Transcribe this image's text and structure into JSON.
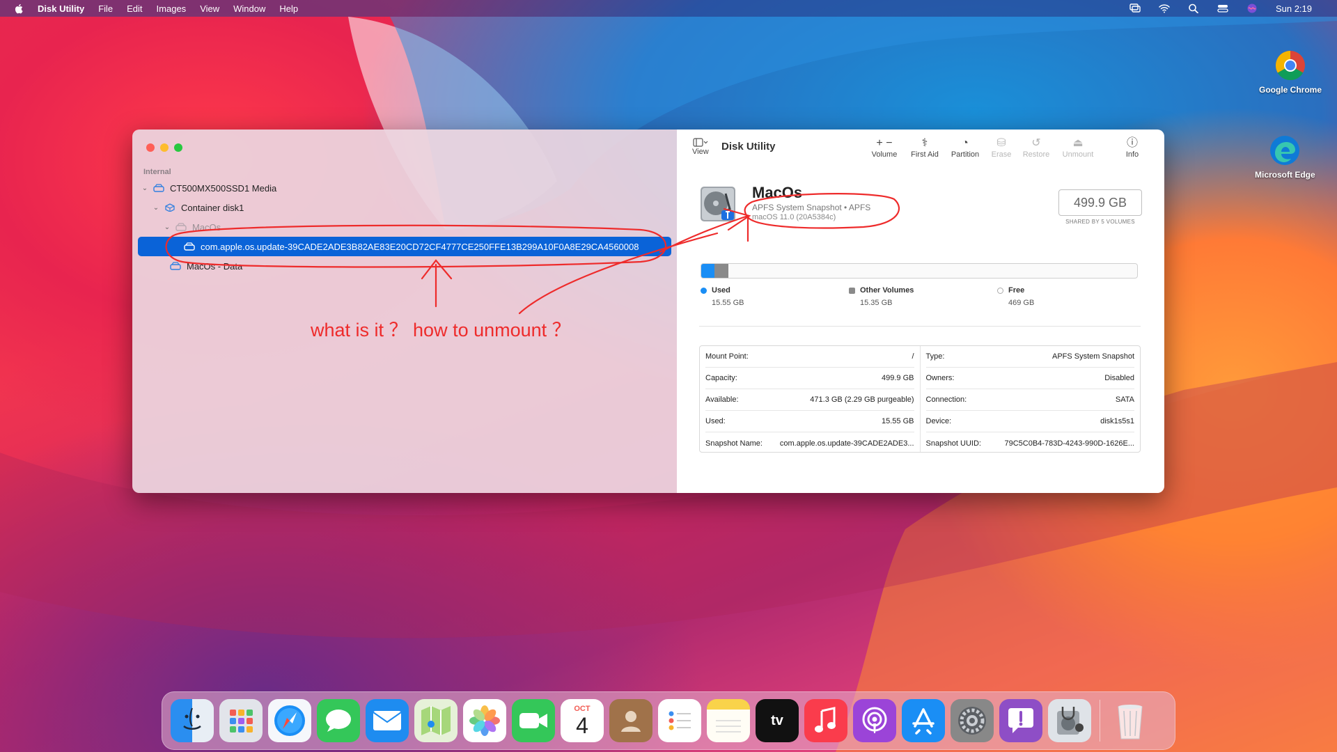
{
  "menubar": {
    "app_name": "Disk Utility",
    "items": [
      "File",
      "Edit",
      "Images",
      "View",
      "Window",
      "Help"
    ],
    "clock": "Sun 2:19"
  },
  "desktop_icons": [
    {
      "label": "Google Chrome"
    },
    {
      "label": "Microsoft Edge"
    }
  ],
  "sidebar": {
    "section": "Internal",
    "items": [
      {
        "label": "CT500MX500SSD1 Media"
      },
      {
        "label": "Container disk1"
      },
      {
        "label": "MacOs"
      },
      {
        "label": "com.apple.os.update-39CADE2ADE3B82AE83E20CD72CF4777CE250FFE13B299A10F0A8E29CA4560008"
      },
      {
        "label": "MacOs - Data"
      }
    ]
  },
  "toolbar": {
    "view_label": "View",
    "title": "Disk Utility",
    "buttons": [
      {
        "label": "Volume",
        "glyph": "+  −"
      },
      {
        "label": "First Aid",
        "glyph": "⚕"
      },
      {
        "label": "Partition",
        "glyph": "◔"
      },
      {
        "label": "Erase",
        "glyph": "⛁"
      },
      {
        "label": "Restore",
        "glyph": "↺"
      },
      {
        "label": "Unmount",
        "glyph": "⏏"
      },
      {
        "label": "Info",
        "glyph": "ⓘ"
      }
    ]
  },
  "volume": {
    "name": "MacOs",
    "subtitle": "APFS System Snapshot • APFS",
    "version": "macOS 11.0 (20A5384c)",
    "size": "499.9 GB",
    "size_caption": "SHARED BY 5 VOLUMES"
  },
  "usage": {
    "used_fraction": 0.031,
    "other_fraction": 0.031,
    "legend": [
      {
        "label": "Used",
        "value": "15.55 GB",
        "color": "#1a8ef5"
      },
      {
        "label": "Other Volumes",
        "value": "15.35 GB",
        "color": "#8a8a8a"
      },
      {
        "label": "Free",
        "value": "469 GB",
        "color": "#ffffff"
      }
    ]
  },
  "info": {
    "left": [
      {
        "key": "Mount Point:",
        "value": "/"
      },
      {
        "key": "Capacity:",
        "value": "499.9 GB"
      },
      {
        "key": "Available:",
        "value": "471.3 GB (2.29 GB purgeable)"
      },
      {
        "key": "Used:",
        "value": "15.55 GB"
      },
      {
        "key": "Snapshot Name:",
        "value": "com.apple.os.update-39CADE2ADE3..."
      }
    ],
    "right": [
      {
        "key": "Type:",
        "value": "APFS System Snapshot"
      },
      {
        "key": "Owners:",
        "value": "Disabled"
      },
      {
        "key": "Connection:",
        "value": "SATA"
      },
      {
        "key": "Device:",
        "value": "disk1s5s1"
      },
      {
        "key": "Snapshot UUID:",
        "value": "79C5C0B4-783D-4243-990D-1626E..."
      }
    ]
  },
  "annotation": {
    "text": "what is it  ？ how to unmount ？",
    "color": "#ee2b2b"
  },
  "dock": {
    "calendar_month": "OCT",
    "calendar_day": "4",
    "tv_label": "tv"
  }
}
